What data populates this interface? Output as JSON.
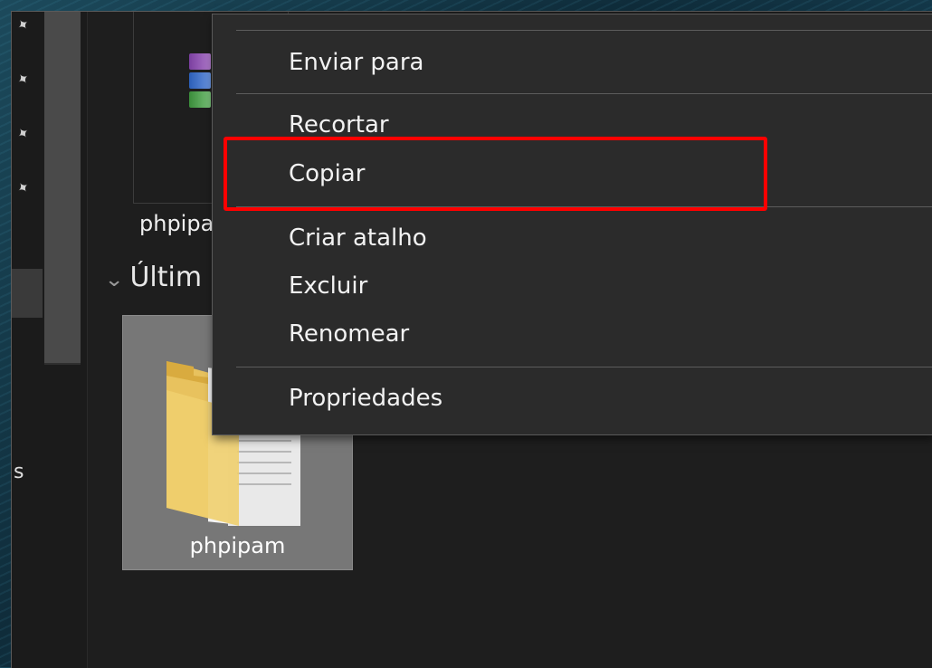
{
  "nav": {
    "partial_label": "s"
  },
  "pins": [
    "pin-icon",
    "pin-icon",
    "pin-icon",
    "pin-icon"
  ],
  "files": {
    "top_item_name": "phpipa",
    "group_header": "Últim",
    "folder_item_name": "phpipam"
  },
  "menu": {
    "send_to": "Enviar para",
    "cut": "Recortar",
    "copy": "Copiar",
    "create_shortcut": "Criar atalho",
    "delete": "Excluir",
    "rename": "Renomear",
    "properties": "Propriedades"
  },
  "annotation": {
    "highlight_color": "#ff0000",
    "highlighted_item": "Copiar"
  }
}
